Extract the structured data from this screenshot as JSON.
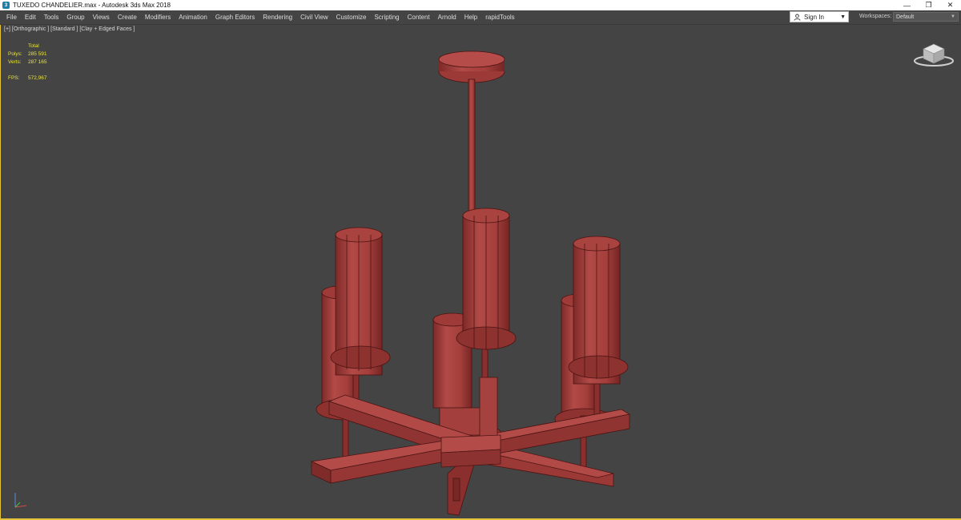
{
  "title_bar": {
    "title": "TUXEDO CHANDELIER.max - Autodesk 3ds Max 2018",
    "app_icon": "3ds-max-icon",
    "controls": [
      "minimize-icon",
      "restore-icon",
      "close-icon"
    ]
  },
  "menu": [
    "File",
    "Edit",
    "Tools",
    "Group",
    "Views",
    "Create",
    "Modifiers",
    "Animation",
    "Graph Editors",
    "Rendering",
    "Civil View",
    "Customize",
    "Scripting",
    "Content",
    "Arnold",
    "Help",
    "rapidTools"
  ],
  "account": {
    "sign_in": "Sign In",
    "icon": "user-icon"
  },
  "workspaces": {
    "label": "Workspaces:",
    "value": "Default"
  },
  "viewport": {
    "label": "[+] [Orthographic ] [Standard ] [Clay + Edged Faces ]",
    "stats": {
      "header": "Total",
      "polys_label": "Polys:",
      "polys_value": "285 591",
      "verts_label": "Verts:",
      "verts_value": "287 165",
      "fps_label": "FPS:",
      "fps_value": "572,967"
    },
    "colors": {
      "model": "#a8403e",
      "model_dark": "#7a2826",
      "edges": "#4a1412",
      "stats": "#e8e33a",
      "border": "#e2c33a"
    }
  }
}
